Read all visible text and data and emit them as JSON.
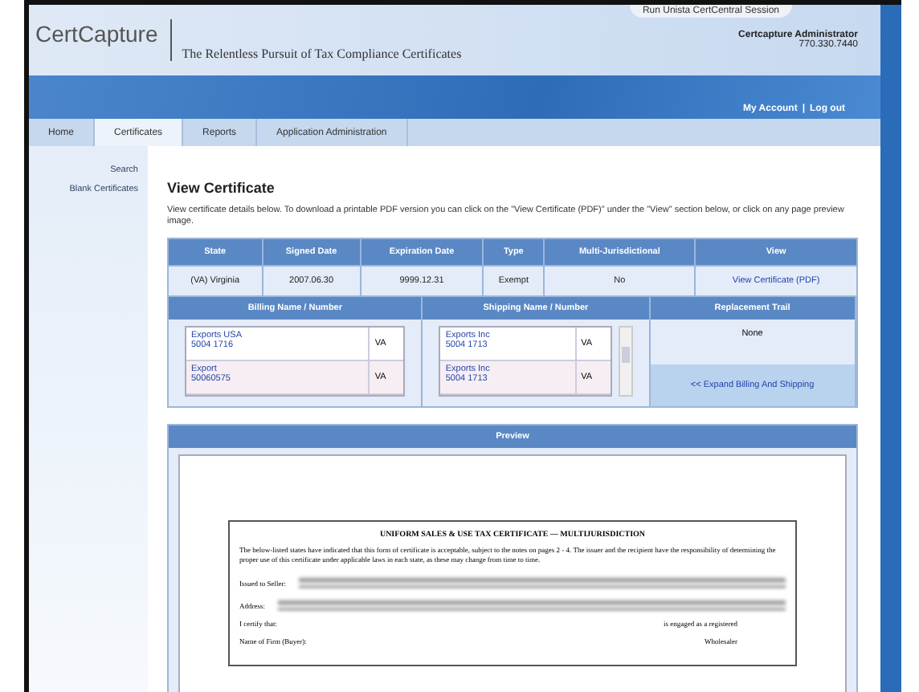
{
  "session_link": "Run Unista CertCentral Session",
  "logo": "CertCapture",
  "tagline": "The Relentless Pursuit of Tax Compliance Certificates",
  "user": {
    "name": "Certcapture Administrator",
    "phone": "770.330.7440"
  },
  "account_links": [
    {
      "label": "My Account"
    },
    {
      "label": "Log out"
    }
  ],
  "account_separator": "|",
  "tabs": [
    {
      "label": "Home",
      "selected": false
    },
    {
      "label": "Certificates",
      "selected": true
    },
    {
      "label": "Reports",
      "selected": false
    },
    {
      "label": "Application Administration",
      "selected": false
    }
  ],
  "sidebar": {
    "items": [
      {
        "label": "Search"
      },
      {
        "label": "Blank Certificates"
      }
    ]
  },
  "page_title": "View Certificate",
  "intro": "View certificate details below. To download a printable PDF version you can click on the \"View Certificate (PDF)\" under the \"View\" section below, or click on any page preview image.",
  "summary_table": {
    "columns": [
      "State",
      "Signed Date",
      "Expiration Date",
      "Type",
      "Multi-Jurisdictional",
      "View"
    ],
    "row": [
      "(VA) Virginia",
      "2007.06.30",
      "9999.12.31",
      "Exempt",
      "No",
      "View Certificate (PDF)"
    ]
  },
  "billing": {
    "heading": "Billing Name / Number",
    "entries": [
      {
        "name": "Exports USA",
        "number": "5004 1716",
        "state": "VA"
      },
      {
        "name": "Export",
        "number": "50060575",
        "state": "VA"
      }
    ]
  },
  "shipping": {
    "heading": "Shipping Name / Number",
    "entries": [
      {
        "name": "Exports Inc",
        "number": "5004 1713",
        "state": "VA"
      },
      {
        "name": "Exports Inc",
        "number": "5004 1713",
        "state": "VA"
      }
    ]
  },
  "replacement": {
    "heading": "Replacement Trail",
    "value": "None",
    "expand_link": "<< Expand Billing And Shipping"
  },
  "preview": {
    "heading": "Preview",
    "document": {
      "title": "UNIFORM SALES & USE TAX CERTIFICATE — MULTIJURISDICTION",
      "paragraph": "The below-listed states have indicated that this form of certificate is acceptable, subject to the notes on pages 2 - 4. The issuer and the recipient have the responsibility of determining the proper use of this certificate under applicable laws in each state, as these may change from time to time.",
      "fields": [
        {
          "label": "Issued to Seller:"
        },
        {
          "label": "Address:"
        }
      ],
      "certify": "I certify that:",
      "registered": "is engaged as a registered",
      "firm": "Name of Firm (Buyer):",
      "wholesaler": "Wholesaler"
    }
  }
}
